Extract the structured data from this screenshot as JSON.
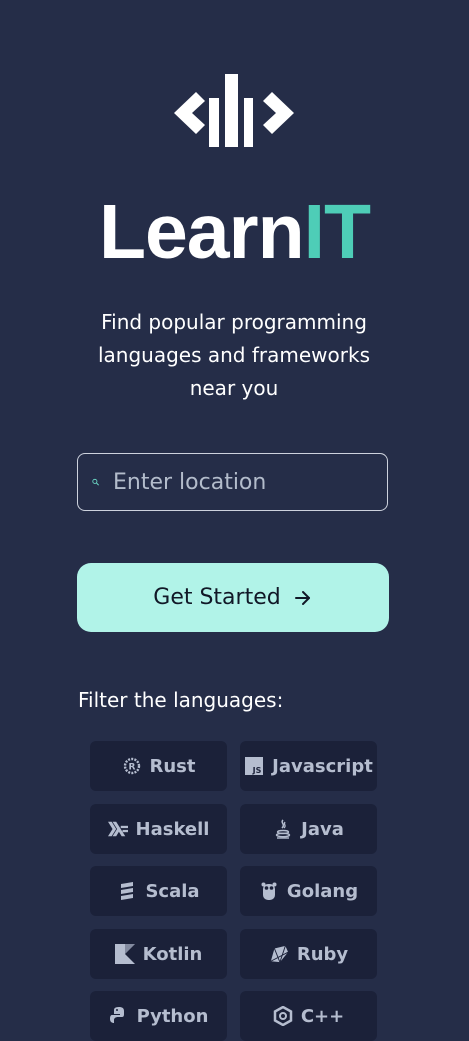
{
  "brand": {
    "name_part1": "Learn",
    "name_part2": "IT",
    "accent_color": "#4ecdb7"
  },
  "tagline": "Find popular programming languages and frameworks near you",
  "search": {
    "placeholder": "Enter location",
    "value": "",
    "icon": "search-icon"
  },
  "cta": {
    "label": "Get Started",
    "icon": "arrow-right-icon",
    "background": "#b1f3e8"
  },
  "filters": {
    "heading": "Filter the languages:",
    "items": [
      {
        "label": "Rust",
        "icon": "rust-icon"
      },
      {
        "label": "Javascript",
        "icon": "javascript-icon"
      },
      {
        "label": "Haskell",
        "icon": "haskell-icon"
      },
      {
        "label": "Java",
        "icon": "java-icon"
      },
      {
        "label": "Scala",
        "icon": "scala-icon"
      },
      {
        "label": "Golang",
        "icon": "golang-icon"
      },
      {
        "label": "Kotlin",
        "icon": "kotlin-icon"
      },
      {
        "label": "Ruby",
        "icon": "ruby-icon"
      },
      {
        "label": "Python",
        "icon": "python-icon"
      },
      {
        "label": "C++",
        "icon": "cpp-icon"
      }
    ]
  },
  "colors": {
    "background": "#252d48",
    "chip_background": "#1b2139",
    "chip_text": "#b5bdcf"
  }
}
